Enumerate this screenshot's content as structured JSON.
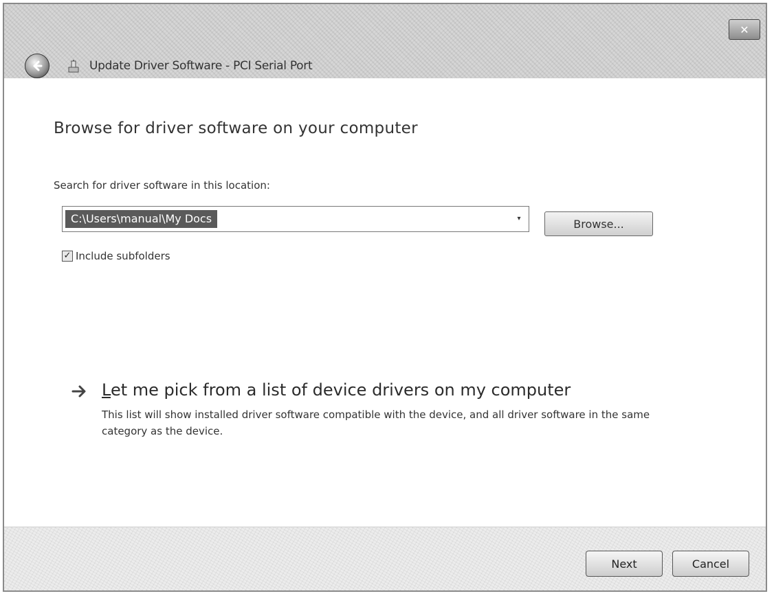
{
  "window": {
    "title": "Update Driver Software - PCI Serial Port",
    "close_glyph": "✕"
  },
  "content": {
    "heading": "Browse for driver software on your computer",
    "location_label": "Search for driver software in this location:",
    "location_value": "C:\\Users\\manual\\My Docs",
    "dropdown_glyph": "▾",
    "browse_label": "Browse...",
    "include_subfolders": {
      "checked": true,
      "check_glyph": "✓",
      "label": "Include subfolders"
    },
    "pick_option": {
      "title": "Let me pick from a list of device drivers on my computer",
      "title_accel": "L",
      "title_rest": "et me pick from a list of device drivers on my computer",
      "description": "This list will show installed driver software compatible with the device, and all driver software in the same category as the device."
    }
  },
  "footer": {
    "next_label": "Next",
    "cancel_label": "Cancel"
  },
  "icons": {
    "back": "back-arrow-icon",
    "title": "device-driver-icon",
    "pick_arrow": "green-arrow-icon"
  }
}
